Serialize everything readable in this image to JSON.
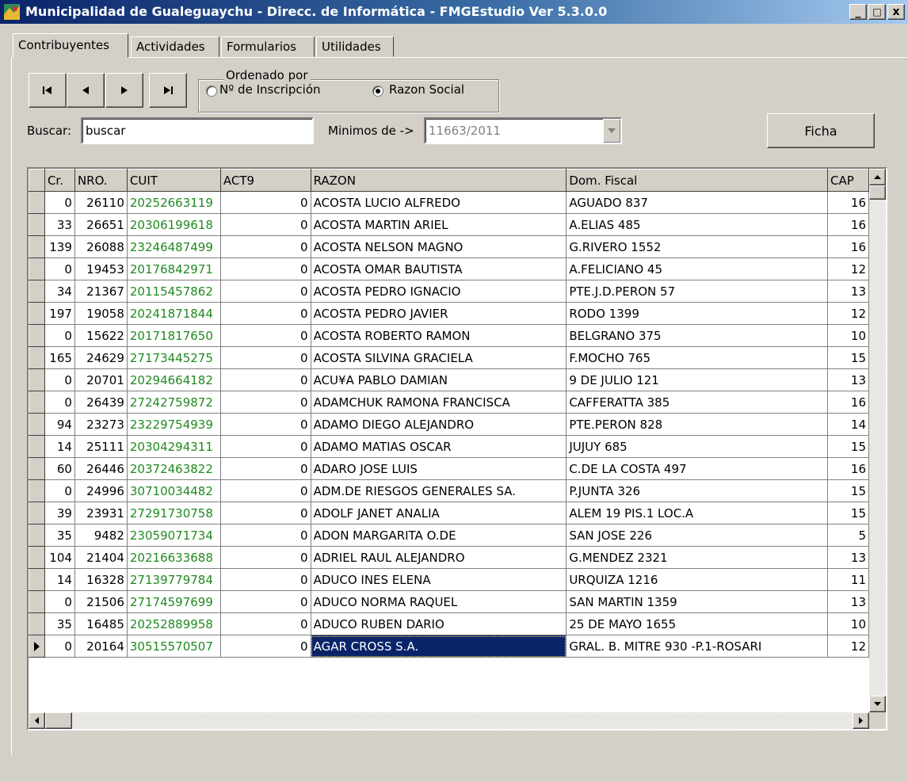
{
  "window": {
    "title": "Municipalidad de Gualeguaychu - Direcc. de Informática  -  FMGEstudio  Ver 5.3.0.0",
    "minimize_label": "_",
    "maximize_label": "□",
    "close_label": "x"
  },
  "tabs": [
    {
      "label": "Contribuyentes",
      "active": true
    },
    {
      "label": "Actividades"
    },
    {
      "label": "Formularios"
    },
    {
      "label": "Utilidades"
    }
  ],
  "navigation": {
    "icons": [
      "first-record-icon",
      "prev-record-icon",
      "next-record-icon",
      "last-record-icon"
    ]
  },
  "order_group": {
    "legend": "Ordenado por",
    "option_inscripcion": "Nº de Inscripción",
    "option_razon": "Razon Social",
    "selected": "Razon Social"
  },
  "search": {
    "label": "Buscar:",
    "value": "buscar"
  },
  "minimos": {
    "label": "Minimos de ->",
    "value": "11663/2011"
  },
  "ficha_button": "Ficha",
  "grid": {
    "columns": [
      "Cr.",
      "NRO.",
      "CUIT",
      "ACT9",
      "RAZON",
      "Dom. Fiscal",
      "CAP"
    ],
    "rows": [
      {
        "cr": "0",
        "nro": "26110",
        "cuit": "20252663119",
        "act9": "0",
        "razon": "ACOSTA LUCIO ALFREDO",
        "dom": "AGUADO 837",
        "cap": "16"
      },
      {
        "cr": "33",
        "nro": "26651",
        "cuit": "20306199618",
        "act9": "0",
        "razon": "ACOSTA MARTIN ARIEL",
        "dom": "A.ELIAS 485",
        "cap": "16"
      },
      {
        "cr": "139",
        "nro": "26088",
        "cuit": "23246487499",
        "act9": "0",
        "razon": "ACOSTA NELSON MAGNO",
        "dom": "G.RIVERO 1552",
        "cap": "16"
      },
      {
        "cr": "0",
        "nro": "19453",
        "cuit": "20176842971",
        "act9": "0",
        "razon": "ACOSTA OMAR BAUTISTA",
        "dom": "A.FELICIANO 45",
        "cap": "12"
      },
      {
        "cr": "34",
        "nro": "21367",
        "cuit": "20115457862",
        "act9": "0",
        "razon": "ACOSTA PEDRO IGNACIO",
        "dom": "PTE.J.D.PERON 57",
        "cap": "13"
      },
      {
        "cr": "197",
        "nro": "19058",
        "cuit": "20241871844",
        "act9": "0",
        "razon": "ACOSTA PEDRO JAVIER",
        "dom": "RODO 1399",
        "cap": "12"
      },
      {
        "cr": "0",
        "nro": "15622",
        "cuit": "20171817650",
        "act9": "0",
        "razon": "ACOSTA ROBERTO RAMON",
        "dom": "BELGRANO 375",
        "cap": "10"
      },
      {
        "cr": "165",
        "nro": "24629",
        "cuit": "27173445275",
        "act9": "0",
        "razon": "ACOSTA SILVINA GRACIELA",
        "dom": "F.MOCHO 765",
        "cap": "15"
      },
      {
        "cr": "0",
        "nro": "20701",
        "cuit": "20294664182",
        "act9": "0",
        "razon": "ACU¥A PABLO DAMIAN",
        "dom": "9 DE JULIO 121",
        "cap": "13"
      },
      {
        "cr": "0",
        "nro": "26439",
        "cuit": "27242759872",
        "act9": "0",
        "razon": "ADAMCHUK RAMONA FRANCISCA",
        "dom": "CAFFERATTA 385",
        "cap": "16"
      },
      {
        "cr": "94",
        "nro": "23273",
        "cuit": "23229754939",
        "act9": "0",
        "razon": "ADAMO DIEGO ALEJANDRO",
        "dom": "PTE.PERON 828",
        "cap": "14"
      },
      {
        "cr": "14",
        "nro": "25111",
        "cuit": "20304294311",
        "act9": "0",
        "razon": "ADAMO MATIAS OSCAR",
        "dom": "JUJUY 685",
        "cap": "15"
      },
      {
        "cr": "60",
        "nro": "26446",
        "cuit": "20372463822",
        "act9": "0",
        "razon": "ADARO JOSE LUIS",
        "dom": "C.DE LA COSTA 497",
        "cap": "16"
      },
      {
        "cr": "0",
        "nro": "24996",
        "cuit": "30710034482",
        "act9": "0",
        "razon": "ADM.DE RIESGOS GENERALES SA.",
        "dom": "P.JUNTA 326",
        "cap": "15"
      },
      {
        "cr": "39",
        "nro": "23931",
        "cuit": "27291730758",
        "act9": "0",
        "razon": "ADOLF JANET ANALIA",
        "dom": "ALEM 19 PIS.1 LOC.A",
        "cap": "15"
      },
      {
        "cr": "35",
        "nro": "9482",
        "cuit": "23059071734",
        "act9": "0",
        "razon": "ADON MARGARITA O.DE",
        "dom": "SAN JOSE 226",
        "cap": "5"
      },
      {
        "cr": "104",
        "nro": "21404",
        "cuit": "20216633688",
        "act9": "0",
        "razon": "ADRIEL RAUL ALEJANDRO",
        "dom": "G.MENDEZ 2321",
        "cap": "13"
      },
      {
        "cr": "14",
        "nro": "16328",
        "cuit": "27139779784",
        "act9": "0",
        "razon": "ADUCO INES ELENA",
        "dom": "URQUIZA 1216",
        "cap": "11"
      },
      {
        "cr": "0",
        "nro": "21506",
        "cuit": "27174597699",
        "act9": "0",
        "razon": "ADUCO NORMA RAQUEL",
        "dom": "SAN MARTIN 1359",
        "cap": "13"
      },
      {
        "cr": "35",
        "nro": "16485",
        "cuit": "20252889958",
        "act9": "0",
        "razon": "ADUCO RUBEN DARIO",
        "dom": "25 DE MAYO 1655",
        "cap": "10"
      },
      {
        "cr": "0",
        "nro": "20164",
        "cuit": "30515570507",
        "act9": "0",
        "razon": "AGAR CROSS S.A.",
        "dom": "GRAL. B. MITRE 930 -P.1-ROSARI",
        "cap": "12",
        "selected": true
      }
    ]
  },
  "colors": {
    "cuit_text": "#1f8a1f",
    "selection_bg": "#0a246a",
    "titlebar_start": "#0a246a",
    "window_bg": "#d4d0c8"
  }
}
